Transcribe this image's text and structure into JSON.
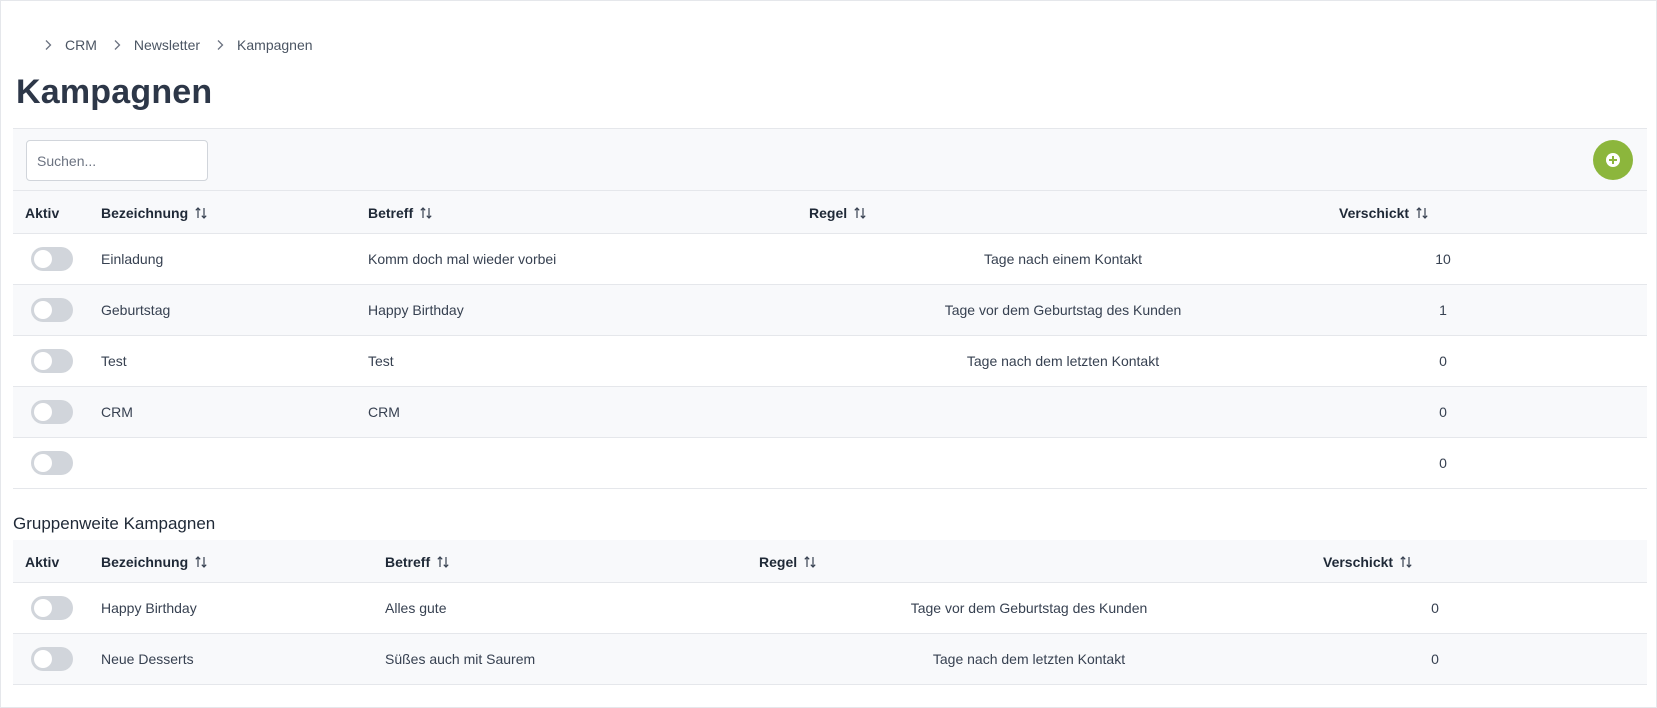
{
  "breadcrumb": [
    "CRM",
    "Newsletter",
    "Kampagnen"
  ],
  "page_title": "Kampagnen",
  "search": {
    "placeholder": "Suchen...",
    "value": ""
  },
  "colors": {
    "accent": "#8cb63c",
    "toggle_off": "#d1d5db",
    "header_bg": "#f8f9fb"
  },
  "campaigns": {
    "columns": [
      "Aktiv",
      "Bezeichnung",
      "Betreff",
      "Regel",
      "Verschickt"
    ],
    "rows": [
      {
        "active": false,
        "name": "Einladung",
        "subject": "Komm doch mal wieder vorbei",
        "rule": "Tage nach einem Kontakt",
        "sent": "10"
      },
      {
        "active": false,
        "name": "Geburtstag",
        "subject": "Happy Birthday",
        "rule": "Tage vor dem Geburtstag des Kunden",
        "sent": "1"
      },
      {
        "active": false,
        "name": "Test",
        "subject": "Test",
        "rule": "Tage nach dem letzten Kontakt",
        "sent": "0"
      },
      {
        "active": false,
        "name": "CRM",
        "subject": "CRM",
        "rule": "",
        "sent": "0"
      },
      {
        "active": false,
        "name": "",
        "subject": "",
        "rule": "",
        "sent": "0"
      }
    ]
  },
  "group_campaigns": {
    "title": "Gruppenweite Kampagnen",
    "columns": [
      "Aktiv",
      "Bezeichnung",
      "Betreff",
      "Regel",
      "Verschickt"
    ],
    "rows": [
      {
        "active": false,
        "name": "Happy Birthday",
        "subject": "Alles gute",
        "rule": "Tage vor dem Geburtstag des Kunden",
        "sent": "0"
      },
      {
        "active": false,
        "name": "Neue Desserts",
        "subject": "Süßes auch mit Saurem",
        "rule": "Tage nach dem letzten Kontakt",
        "sent": "0"
      }
    ]
  }
}
